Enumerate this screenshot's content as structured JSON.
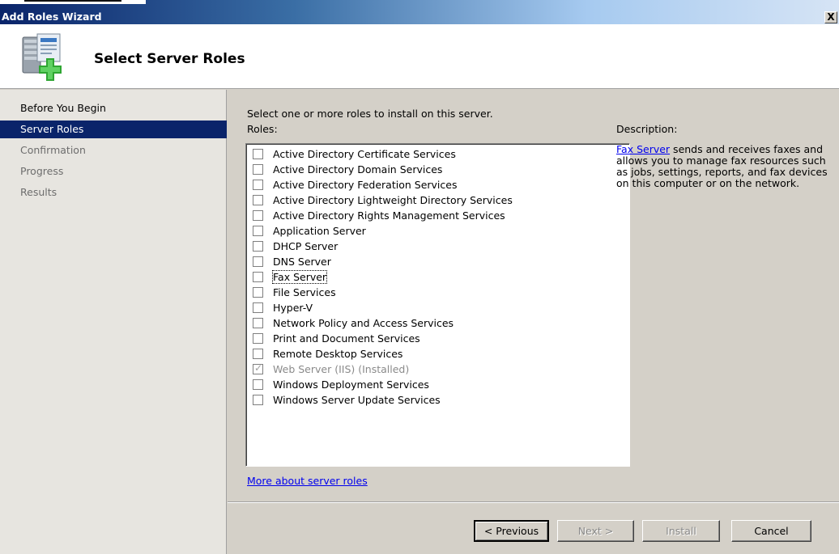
{
  "window": {
    "title": "Add Roles Wizard",
    "close_label": "X"
  },
  "header": {
    "title": "Select Server Roles",
    "icon": "server-add-icon"
  },
  "nav": {
    "items": [
      {
        "label": "Before You Begin",
        "state": "done"
      },
      {
        "label": "Server Roles",
        "state": "active"
      },
      {
        "label": "Confirmation",
        "state": "pending"
      },
      {
        "label": "Progress",
        "state": "pending"
      },
      {
        "label": "Results",
        "state": "pending"
      }
    ]
  },
  "main": {
    "instruction": "Select one or more roles to install on this server.",
    "roles_label": "Roles:",
    "roles": [
      {
        "label": "Active Directory Certificate Services",
        "checked": false,
        "disabled": false
      },
      {
        "label": "Active Directory Domain Services",
        "checked": false,
        "disabled": false
      },
      {
        "label": "Active Directory Federation Services",
        "checked": false,
        "disabled": false
      },
      {
        "label": "Active Directory Lightweight Directory Services",
        "checked": false,
        "disabled": false
      },
      {
        "label": "Active Directory Rights Management Services",
        "checked": false,
        "disabled": false
      },
      {
        "label": "Application Server",
        "checked": false,
        "disabled": false
      },
      {
        "label": "DHCP Server",
        "checked": false,
        "disabled": false
      },
      {
        "label": "DNS Server",
        "checked": false,
        "disabled": false
      },
      {
        "label": "Fax Server",
        "checked": false,
        "disabled": false,
        "selected": true
      },
      {
        "label": "File Services",
        "checked": false,
        "disabled": false
      },
      {
        "label": "Hyper-V",
        "checked": false,
        "disabled": false
      },
      {
        "label": "Network Policy and Access Services",
        "checked": false,
        "disabled": false
      },
      {
        "label": "Print and Document Services",
        "checked": false,
        "disabled": false
      },
      {
        "label": "Remote Desktop Services",
        "checked": false,
        "disabled": false
      },
      {
        "label": "Web Server (IIS)  (Installed)",
        "checked": true,
        "disabled": true
      },
      {
        "label": "Windows Deployment Services",
        "checked": false,
        "disabled": false
      },
      {
        "label": "Windows Server Update Services",
        "checked": false,
        "disabled": false
      }
    ],
    "more_link": "More about server roles"
  },
  "description": {
    "label": "Description:",
    "link_text": "Fax Server",
    "text": " sends and receives faxes and allows you to manage fax resources such as jobs, settings, reports, and fax devices on this computer or on the network."
  },
  "footer": {
    "previous_label": "< Previous",
    "next_label": "Next >",
    "install_label": "Install",
    "cancel_label": "Cancel"
  }
}
